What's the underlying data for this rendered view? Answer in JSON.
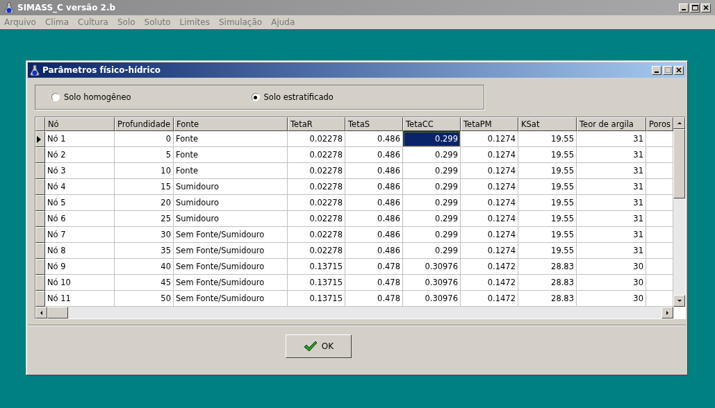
{
  "app": {
    "title": "SIMASS_C versão 2.b"
  },
  "menu": [
    "Arquivo",
    "Clima",
    "Cultura",
    "Solo",
    "Soluto",
    "Limites",
    "Simulação",
    "Ajuda"
  ],
  "dialog": {
    "title": "Parâmetros físico-hídrico",
    "soil_type": [
      {
        "label": "Solo homogêneo",
        "selected": false
      },
      {
        "label": "Solo estratificado",
        "selected": true
      }
    ],
    "table": {
      "columns": [
        "Nó",
        "Profundidade",
        "Fonte",
        "TetaR",
        "TetaS",
        "TetaCC",
        "TetaPM",
        "KSat",
        "Teor de argila",
        "Poros"
      ],
      "rows": [
        {
          "selected": true,
          "cells": [
            {
              "text": "Nó 1",
              "focused": false
            },
            {
              "text": "0",
              "focused": false
            },
            {
              "text": "Fonte",
              "focused": false
            },
            {
              "text": "0.02278",
              "focused": false
            },
            {
              "text": "0.486",
              "focused": false
            },
            {
              "text": "0.299",
              "focused": true
            },
            {
              "text": "0.1274",
              "focused": false
            },
            {
              "text": "19.55",
              "focused": false
            },
            {
              "text": "31",
              "focused": false
            }
          ]
        },
        {
          "selected": false,
          "cells": [
            {
              "text": "Nó 2",
              "focused": false
            },
            {
              "text": "5",
              "focused": false
            },
            {
              "text": "Fonte",
              "focused": false
            },
            {
              "text": "0.02278",
              "focused": false
            },
            {
              "text": "0.486",
              "focused": false
            },
            {
              "text": "0.299",
              "focused": false
            },
            {
              "text": "0.1274",
              "focused": false
            },
            {
              "text": "19.55",
              "focused": false
            },
            {
              "text": "31",
              "focused": false
            }
          ]
        },
        {
          "selected": false,
          "cells": [
            {
              "text": "Nó 3",
              "focused": false
            },
            {
              "text": "10",
              "focused": false
            },
            {
              "text": "Fonte",
              "focused": false
            },
            {
              "text": "0.02278",
              "focused": false
            },
            {
              "text": "0.486",
              "focused": false
            },
            {
              "text": "0.299",
              "focused": false
            },
            {
              "text": "0.1274",
              "focused": false
            },
            {
              "text": "19.55",
              "focused": false
            },
            {
              "text": "31",
              "focused": false
            }
          ]
        },
        {
          "selected": false,
          "cells": [
            {
              "text": "Nó 4",
              "focused": false
            },
            {
              "text": "15",
              "focused": false
            },
            {
              "text": "Sumidouro",
              "focused": false
            },
            {
              "text": "0.02278",
              "focused": false
            },
            {
              "text": "0.486",
              "focused": false
            },
            {
              "text": "0.299",
              "focused": false
            },
            {
              "text": "0.1274",
              "focused": false
            },
            {
              "text": "19.55",
              "focused": false
            },
            {
              "text": "31",
              "focused": false
            }
          ]
        },
        {
          "selected": false,
          "cells": [
            {
              "text": "Nó 5",
              "focused": false
            },
            {
              "text": "20",
              "focused": false
            },
            {
              "text": "Sumidouro",
              "focused": false
            },
            {
              "text": "0.02278",
              "focused": false
            },
            {
              "text": "0.486",
              "focused": false
            },
            {
              "text": "0.299",
              "focused": false
            },
            {
              "text": "0.1274",
              "focused": false
            },
            {
              "text": "19.55",
              "focused": false
            },
            {
              "text": "31",
              "focused": false
            }
          ]
        },
        {
          "selected": false,
          "cells": [
            {
              "text": "Nó 6",
              "focused": false
            },
            {
              "text": "25",
              "focused": false
            },
            {
              "text": "Sumidouro",
              "focused": false
            },
            {
              "text": "0.02278",
              "focused": false
            },
            {
              "text": "0.486",
              "focused": false
            },
            {
              "text": "0.299",
              "focused": false
            },
            {
              "text": "0.1274",
              "focused": false
            },
            {
              "text": "19.55",
              "focused": false
            },
            {
              "text": "31",
              "focused": false
            }
          ]
        },
        {
          "selected": false,
          "cells": [
            {
              "text": "Nó 7",
              "focused": false
            },
            {
              "text": "30",
              "focused": false
            },
            {
              "text": "Sem Fonte/Sumidouro",
              "focused": false
            },
            {
              "text": "0.02278",
              "focused": false
            },
            {
              "text": "0.486",
              "focused": false
            },
            {
              "text": "0.299",
              "focused": false
            },
            {
              "text": "0.1274",
              "focused": false
            },
            {
              "text": "19.55",
              "focused": false
            },
            {
              "text": "31",
              "focused": false
            }
          ]
        },
        {
          "selected": false,
          "cells": [
            {
              "text": "Nó 8",
              "focused": false
            },
            {
              "text": "35",
              "focused": false
            },
            {
              "text": "Sem Fonte/Sumidouro",
              "focused": false
            },
            {
              "text": "0.02278",
              "focused": false
            },
            {
              "text": "0.486",
              "focused": false
            },
            {
              "text": "0.299",
              "focused": false
            },
            {
              "text": "0.1274",
              "focused": false
            },
            {
              "text": "19.55",
              "focused": false
            },
            {
              "text": "31",
              "focused": false
            }
          ]
        },
        {
          "selected": false,
          "cells": [
            {
              "text": "Nó 9",
              "focused": false
            },
            {
              "text": "40",
              "focused": false
            },
            {
              "text": "Sem Fonte/Sumidouro",
              "focused": false
            },
            {
              "text": "0.13715",
              "focused": false
            },
            {
              "text": "0.478",
              "focused": false
            },
            {
              "text": "0.30976",
              "focused": false
            },
            {
              "text": "0.1472",
              "focused": false
            },
            {
              "text": "28.83",
              "focused": false
            },
            {
              "text": "30",
              "focused": false
            }
          ]
        },
        {
          "selected": false,
          "cells": [
            {
              "text": "Nó 10",
              "focused": false
            },
            {
              "text": "45",
              "focused": false
            },
            {
              "text": "Sem Fonte/Sumidouro",
              "focused": false
            },
            {
              "text": "0.13715",
              "focused": false
            },
            {
              "text": "0.478",
              "focused": false
            },
            {
              "text": "0.30976",
              "focused": false
            },
            {
              "text": "0.1472",
              "focused": false
            },
            {
              "text": "28.83",
              "focused": false
            },
            {
              "text": "30",
              "focused": false
            }
          ]
        },
        {
          "selected": false,
          "cells": [
            {
              "text": "Nó 11",
              "focused": false
            },
            {
              "text": "50",
              "focused": false
            },
            {
              "text": "Sem Fonte/Sumidouro",
              "focused": false
            },
            {
              "text": "0.13715",
              "focused": false
            },
            {
              "text": "0.478",
              "focused": false
            },
            {
              "text": "0.30976",
              "focused": false
            },
            {
              "text": "0.1472",
              "focused": false
            },
            {
              "text": "28.83",
              "focused": false
            },
            {
              "text": "30",
              "focused": false
            }
          ]
        }
      ]
    },
    "ok_button": "OK"
  }
}
